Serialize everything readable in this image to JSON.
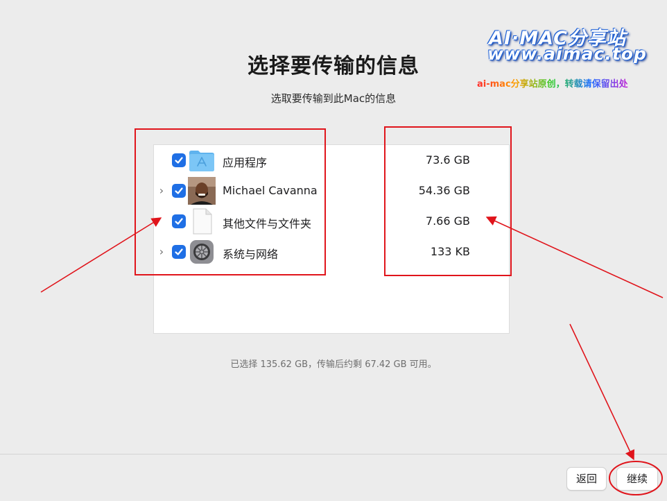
{
  "header": {
    "title": "选择要传输的信息",
    "subtitle": "选取要传输到此Mac的信息"
  },
  "items": [
    {
      "label": "应用程序",
      "size": "73.6 GB",
      "checked": true,
      "expandable": false,
      "icon": "applications-folder-icon"
    },
    {
      "label": "Michael Cavanna",
      "size": "54.36 GB",
      "checked": true,
      "expandable": true,
      "icon": "user-avatar-icon"
    },
    {
      "label": "其他文件与文件夹",
      "size": "7.66 GB",
      "checked": true,
      "expandable": false,
      "icon": "document-icon"
    },
    {
      "label": "系统与网络",
      "size": "133 KB",
      "checked": true,
      "expandable": true,
      "icon": "system-settings-icon"
    }
  ],
  "summary": "已选择 135.62 GB，传输后约剩 67.42 GB 可用。",
  "buttons": {
    "back": "返回",
    "continue": "继续"
  },
  "watermark": {
    "line1": "AI·MAC分享站",
    "line2": "www.aimac.top",
    "line3": "ai-mac分享站原创，转载请保留出处"
  },
  "colors": {
    "accent": "#1f6fe5",
    "annotation": "#e0141b"
  }
}
